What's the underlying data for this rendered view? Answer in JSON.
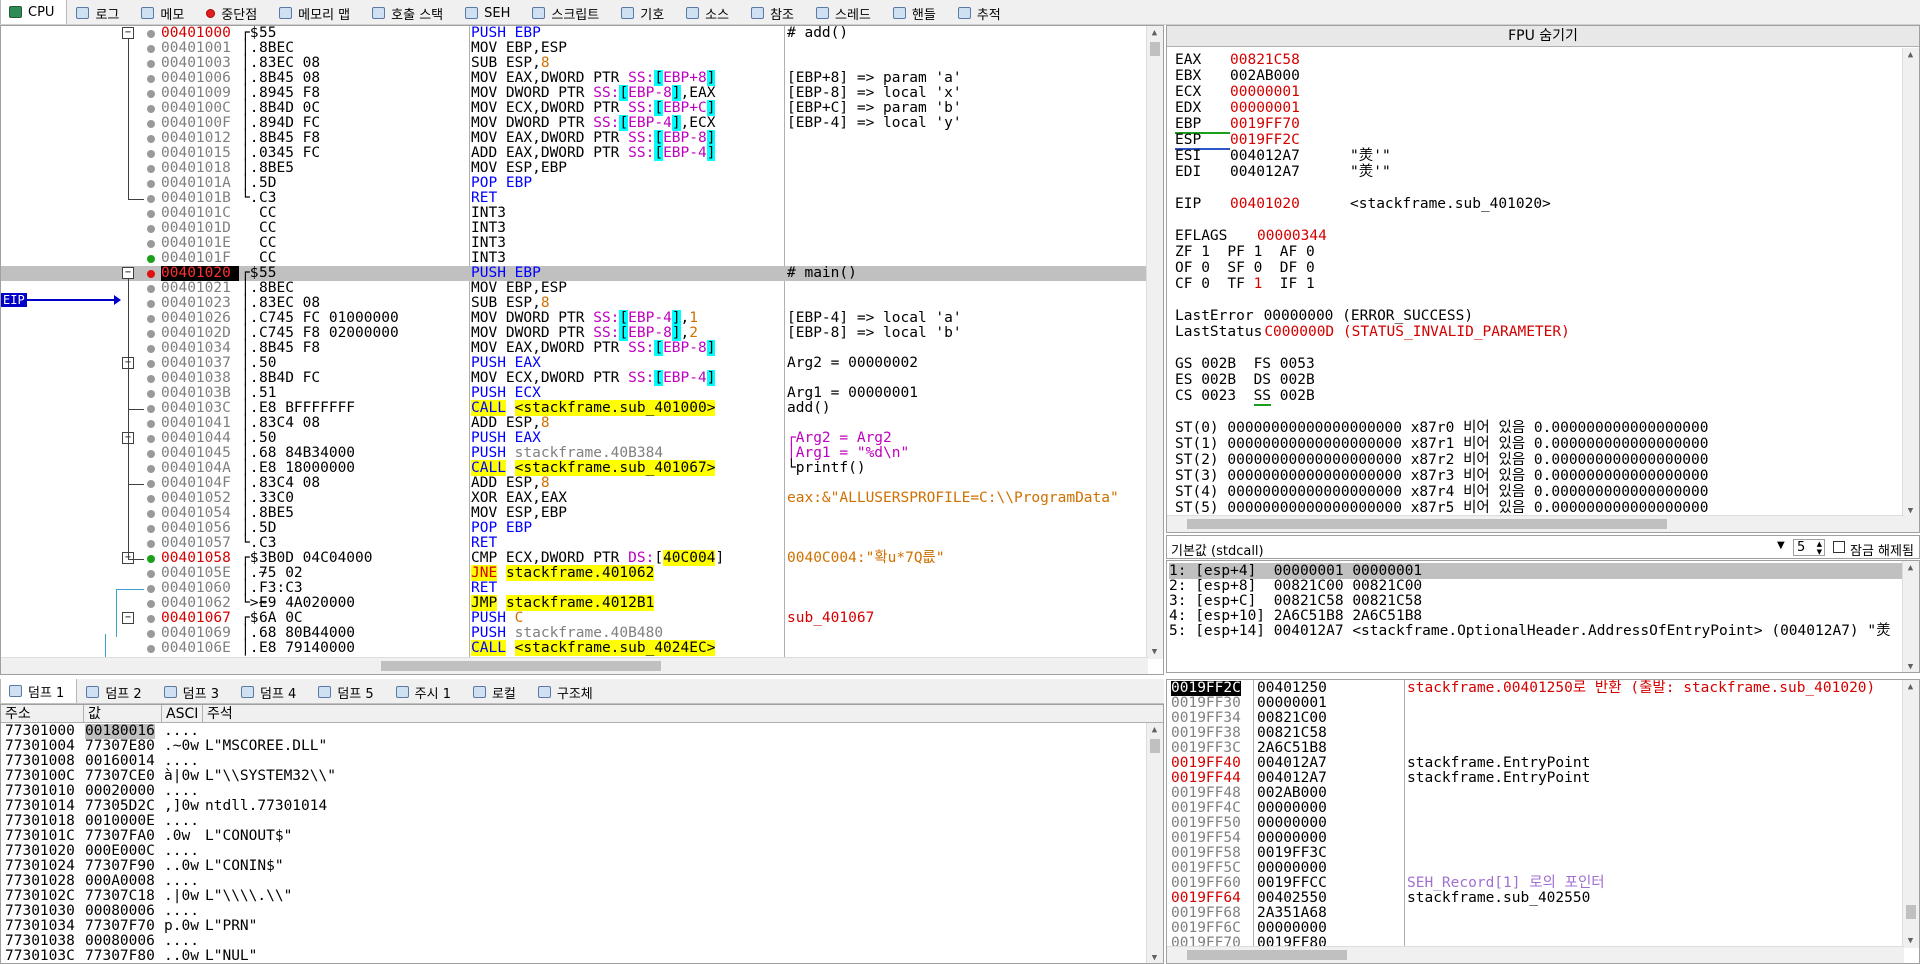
{
  "tabs": [
    {
      "label": "CPU",
      "icon": "cpu-icon",
      "active": true
    },
    {
      "label": "로그",
      "icon": "log-icon"
    },
    {
      "label": "메모",
      "icon": "notes-icon"
    },
    {
      "label": "중단점",
      "icon": "breakpoint-icon"
    },
    {
      "label": "메모리 맵",
      "icon": "memory-map-icon"
    },
    {
      "label": "호출 스택",
      "icon": "call-stack-icon"
    },
    {
      "label": "SEH",
      "icon": "seh-icon"
    },
    {
      "label": "스크립트",
      "icon": "script-icon"
    },
    {
      "label": "기호",
      "icon": "symbols-icon"
    },
    {
      "label": "소스",
      "icon": "source-icon"
    },
    {
      "label": "참조",
      "icon": "references-icon"
    },
    {
      "label": "스레드",
      "icon": "threads-icon"
    },
    {
      "label": "핸들",
      "icon": "handles-icon"
    },
    {
      "label": "추적",
      "icon": "trace-icon"
    }
  ],
  "eip_label": "EIP",
  "disasm": [
    {
      "a": "00401000",
      "l": 1,
      "k": "┌$",
      "b": "55",
      "i": [
        [
          "PUSH EBP",
          "bl"
        ]
      ],
      "c": "# add()"
    },
    {
      "a": "00401001",
      "k": "│.",
      "b": "8BEC",
      "i": [
        [
          "MOV EBP,ESP",
          ""
        ]
      ],
      "c": ""
    },
    {
      "a": "00401003",
      "k": "│.",
      "b": "83EC 08",
      "i": [
        [
          "SUB ESP,",
          ""
        ],
        [
          "8",
          "or"
        ]
      ],
      "c": ""
    },
    {
      "a": "00401006",
      "k": "│.",
      "b": "8B45 08",
      "i": [
        [
          "MOV EAX,DWORD PTR ",
          ""
        ],
        [
          "SS:",
          "mg"
        ],
        [
          "[",
          "hl"
        ],
        [
          "EBP+8",
          "mg"
        ],
        [
          "]",
          "hl"
        ]
      ],
      "c": "[EBP+8] => param 'a'"
    },
    {
      "a": "00401009",
      "k": "│.",
      "b": "8945 F8",
      "i": [
        [
          "MOV DWORD PTR ",
          ""
        ],
        [
          "SS:",
          "mg"
        ],
        [
          "[",
          "hl"
        ],
        [
          "EBP-8",
          "mg"
        ],
        [
          "]",
          "hl"
        ],
        [
          ",EAX",
          ""
        ]
      ],
      "c": "[EBP-8] => local 'x'"
    },
    {
      "a": "0040100C",
      "k": "│.",
      "b": "8B4D 0C",
      "i": [
        [
          "MOV ECX,DWORD PTR ",
          ""
        ],
        [
          "SS:",
          "mg"
        ],
        [
          "[",
          "hl"
        ],
        [
          "EBP+C",
          "mg"
        ],
        [
          "]",
          "hl"
        ]
      ],
      "c": "[EBP+C] => param 'b'"
    },
    {
      "a": "0040100F",
      "k": "│.",
      "b": "894D FC",
      "i": [
        [
          "MOV DWORD PTR ",
          ""
        ],
        [
          "SS:",
          "mg"
        ],
        [
          "[",
          "hl"
        ],
        [
          "EBP-4",
          "mg"
        ],
        [
          "]",
          "hl"
        ],
        [
          ",ECX",
          ""
        ]
      ],
      "c": "[EBP-4] => local 'y'"
    },
    {
      "a": "00401012",
      "k": "│.",
      "b": "8B45 F8",
      "i": [
        [
          "MOV EAX,DWORD PTR ",
          ""
        ],
        [
          "SS:",
          "mg"
        ],
        [
          "[",
          "hl"
        ],
        [
          "EBP-8",
          "mg"
        ],
        [
          "]",
          "hl"
        ]
      ],
      "c": ""
    },
    {
      "a": "00401015",
      "k": "│.",
      "b": "0345 FC",
      "i": [
        [
          "ADD EAX,DWORD PTR ",
          ""
        ],
        [
          "SS:",
          "mg"
        ],
        [
          "[",
          "hl"
        ],
        [
          "EBP-4",
          "mg"
        ],
        [
          "]",
          "hl"
        ]
      ],
      "c": ""
    },
    {
      "a": "00401018",
      "k": "│.",
      "b": "8BE5",
      "i": [
        [
          "MOV ESP,EBP",
          ""
        ]
      ],
      "c": ""
    },
    {
      "a": "0040101A",
      "k": "│.",
      "b": "5D",
      "i": [
        [
          "POP EBP",
          "bl"
        ]
      ],
      "c": ""
    },
    {
      "a": "0040101B",
      "k": "└.",
      "b": "C3",
      "i": [
        [
          "RET",
          "bl"
        ]
      ],
      "c": ""
    },
    {
      "a": "0040101C",
      "k": "",
      "b": "CC",
      "i": [
        [
          "INT3",
          ""
        ]
      ],
      "c": ""
    },
    {
      "a": "0040101D",
      "k": "",
      "b": "CC",
      "i": [
        [
          "INT3",
          ""
        ]
      ],
      "c": ""
    },
    {
      "a": "0040101E",
      "k": "",
      "b": "CC",
      "i": [
        [
          "INT3",
          ""
        ]
      ],
      "c": ""
    },
    {
      "a": "0040101F",
      "k": "",
      "b": "CC",
      "i": [
        [
          "INT3",
          ""
        ]
      ],
      "c": ""
    },
    {
      "a": "00401020",
      "l": 1,
      "e": 1,
      "k": "┌$",
      "b": "55",
      "i": [
        [
          "PUSH EBP",
          "bl"
        ]
      ],
      "c": "# main()"
    },
    {
      "a": "00401021",
      "k": "│.",
      "b": "8BEC",
      "i": [
        [
          "MOV EBP,ESP",
          ""
        ]
      ],
      "c": ""
    },
    {
      "a": "00401023",
      "k": "│.",
      "b": "83EC 08",
      "i": [
        [
          "SUB ESP,",
          ""
        ],
        [
          "8",
          "or"
        ]
      ],
      "c": ""
    },
    {
      "a": "00401026",
      "k": "│.",
      "b": "C745 FC 01000000",
      "i": [
        [
          "MOV DWORD PTR ",
          ""
        ],
        [
          "SS:",
          "mg"
        ],
        [
          "[",
          "hl"
        ],
        [
          "EBP-4",
          "mg"
        ],
        [
          "]",
          "hl"
        ],
        [
          ",",
          ""
        ],
        [
          "1",
          "or"
        ]
      ],
      "c": "[EBP-4] => local 'a'"
    },
    {
      "a": "0040102D",
      "k": "│.",
      "b": "C745 F8 02000000",
      "i": [
        [
          "MOV DWORD PTR ",
          ""
        ],
        [
          "SS:",
          "mg"
        ],
        [
          "[",
          "hl"
        ],
        [
          "EBP-8",
          "mg"
        ],
        [
          "]",
          "hl"
        ],
        [
          ",",
          ""
        ],
        [
          "2",
          "or"
        ]
      ],
      "c": "[EBP-8] => local 'b'"
    },
    {
      "a": "00401034",
      "k": "│.",
      "b": "8B45 F8",
      "i": [
        [
          "MOV EAX,DWORD PTR ",
          ""
        ],
        [
          "SS:",
          "mg"
        ],
        [
          "[",
          "hl"
        ],
        [
          "EBP-8",
          "mg"
        ],
        [
          "]",
          "hl"
        ]
      ],
      "c": ""
    },
    {
      "a": "00401037",
      "k": "│.",
      "b": "50",
      "i": [
        [
          "PUSH EAX",
          "bl"
        ]
      ],
      "c": "Arg2 = 00000002"
    },
    {
      "a": "00401038",
      "k": "│.",
      "b": "8B4D FC",
      "i": [
        [
          "MOV ECX,DWORD PTR ",
          ""
        ],
        [
          "SS:",
          "mg"
        ],
        [
          "[",
          "hl"
        ],
        [
          "EBP-4",
          "mg"
        ],
        [
          "]",
          "hl"
        ]
      ],
      "c": ""
    },
    {
      "a": "0040103B",
      "k": "│.",
      "b": "51",
      "i": [
        [
          "PUSH ECX",
          "bl"
        ]
      ],
      "c": "Arg1 = 00000001"
    },
    {
      "a": "0040103C",
      "k": "│.",
      "b": "E8 BFFFFFFF",
      "i": [
        [
          "CALL",
          "bl yl"
        ],
        [
          " ",
          ""
        ],
        [
          "<stackframe.sub_401000>",
          "yl"
        ]
      ],
      "c": "add()"
    },
    {
      "a": "00401041",
      "k": "│.",
      "b": "83C4 08",
      "i": [
        [
          "ADD ESP,",
          ""
        ],
        [
          "8",
          "or"
        ]
      ],
      "c": ""
    },
    {
      "a": "00401044",
      "k": "│.",
      "b": "50",
      "i": [
        [
          "PUSH EAX",
          "bl"
        ]
      ],
      "c": "┌Arg2 = Arg2",
      "cc": "mg"
    },
    {
      "a": "00401045",
      "k": "│.",
      "b": "68 84B34000",
      "i": [
        [
          "PUSH ",
          "bl"
        ],
        [
          "stackframe.40B384",
          "gr"
        ]
      ],
      "c": "│Arg1 = \"%d\\n\"",
      "cc": "mg"
    },
    {
      "a": "0040104A",
      "k": "│.",
      "b": "E8 18000000",
      "i": [
        [
          "CALL",
          "bl yl"
        ],
        [
          " ",
          ""
        ],
        [
          "<stackframe.sub_401067>",
          "yl"
        ]
      ],
      "c": "└printf()"
    },
    {
      "a": "0040104F",
      "k": "│.",
      "b": "83C4 08",
      "i": [
        [
          "ADD ESP,",
          ""
        ],
        [
          "8",
          "or"
        ]
      ],
      "c": ""
    },
    {
      "a": "00401052",
      "k": "│.",
      "b": "33C0",
      "i": [
        [
          "XOR EAX,EAX",
          ""
        ]
      ],
      "c": "eax:&\"ALLUSERSPROFILE=C:\\\\ProgramData\"",
      "cc": "or"
    },
    {
      "a": "00401054",
      "k": "│.",
      "b": "8BE5",
      "i": [
        [
          "MOV ESP,EBP",
          ""
        ]
      ],
      "c": ""
    },
    {
      "a": "00401056",
      "k": "│.",
      "b": "5D",
      "i": [
        [
          "POP EBP",
          "bl"
        ]
      ],
      "c": ""
    },
    {
      "a": "00401057",
      "k": "└.",
      "b": "C3",
      "i": [
        [
          "RET",
          "bl"
        ]
      ],
      "c": ""
    },
    {
      "a": "00401058",
      "l": 1,
      "k": "┌$",
      "b": "3B0D 04C04000",
      "i": [
        [
          "CMP ECX,DWORD PTR ",
          ""
        ],
        [
          "DS:",
          "mg"
        ],
        [
          "[",
          ""
        ],
        [
          "40C004",
          "yl"
        ],
        [
          "]",
          ""
        ]
      ],
      "c": "0040C004:\"확u*7Q릆\"",
      "cc": "or"
    },
    {
      "a": "0040105E",
      "k": "│.~",
      "b": "75 02",
      "i": [
        [
          "JNE",
          "rd yl"
        ],
        [
          " ",
          ""
        ],
        [
          "stackframe.401062",
          "yl"
        ]
      ],
      "c": ""
    },
    {
      "a": "00401060",
      "k": "│.",
      "b": "F3:C3",
      "i": [
        [
          "RET",
          "bl"
        ]
      ],
      "c": ""
    },
    {
      "a": "00401062",
      "k": "└>~",
      "b": "E9 4A020000",
      "i": [
        [
          "JMP",
          "yl"
        ],
        [
          " ",
          ""
        ],
        [
          "stackframe.4012B1",
          "yl"
        ]
      ],
      "c": ""
    },
    {
      "a": "00401067",
      "l": 1,
      "k": "┌$",
      "b": "6A 0C",
      "i": [
        [
          "PUSH ",
          "bl"
        ],
        [
          "C",
          "or"
        ]
      ],
      "c": "sub_401067",
      "cc": "rd"
    },
    {
      "a": "00401069",
      "k": "│.",
      "b": "68 80B44000",
      "i": [
        [
          "PUSH ",
          "bl"
        ],
        [
          "stackframe.40B480",
          "gr"
        ]
      ],
      "c": ""
    },
    {
      "a": "0040106E",
      "k": "│.",
      "b": "E8 79140000",
      "i": [
        [
          "CALL",
          "bl yl"
        ],
        [
          " ",
          ""
        ],
        [
          "<stackframe.sub_4024EC>",
          "yl"
        ]
      ],
      "c": ""
    }
  ],
  "fpu_title": "FPU 숨기기",
  "regs": [
    {
      "n": "EAX",
      "v": "00821C58",
      "r": 1,
      "x": ""
    },
    {
      "n": "EBX",
      "v": "002AB000",
      "x": ""
    },
    {
      "n": "ECX",
      "v": "00000001",
      "r": 1,
      "x": ""
    },
    {
      "n": "EDX",
      "v": "00000001",
      "r": 1,
      "x": ""
    },
    {
      "n": "EBP",
      "v": "0019FF70",
      "r": 1,
      "x": "",
      "u": "green"
    },
    {
      "n": "ESP",
      "v": "0019FF2C",
      "r": 1,
      "x": "",
      "u": "blue"
    },
    {
      "n": "ESI",
      "v": "004012A7",
      "x": "\"羙'\""
    },
    {
      "n": "EDI",
      "v": "004012A7",
      "x": "\"羙'\""
    }
  ],
  "eip": {
    "n": "EIP",
    "v": "00401020",
    "x": "<stackframe.sub_401020>"
  },
  "eflags": {
    "n": "EFLAGS",
    "v": "00000344"
  },
  "flags": [
    "ZF 1  PF 1  AF 0",
    "OF 0  SF 0  DF 0"
  ],
  "flags_cf": {
    "a": "CF 0  TF ",
    "b": "1",
    "c": "  IF 1"
  },
  "lasterror": {
    "n": "LastError",
    "v": "00000000 (ERROR_SUCCESS)"
  },
  "laststatus": {
    "n": "LastStatus",
    "v": "C000000D (STATUS_INVALID_PARAMETER)"
  },
  "segs": [
    "GS 002B  FS 0053",
    "ES 002B  DS 002B"
  ],
  "seg_cs": {
    "a": "CS 0023  ",
    "b": "SS",
    "c": " 002B"
  },
  "st": [
    "ST(0) 00000000000000000000 x87r0 비어 있음 0.000000000000000000",
    "ST(1) 00000000000000000000 x87r1 비어 있음 0.000000000000000000",
    "ST(2) 00000000000000000000 x87r2 비어 있음 0.000000000000000000",
    "ST(3) 00000000000000000000 x87r3 비어 있음 0.000000000000000000",
    "ST(4) 00000000000000000000 x87r4 비어 있음 0.000000000000000000",
    "ST(5) 00000000000000000000 x87r5 비어 있음 0.000000000000000000"
  ],
  "callconv": {
    "label": "기본값 (stdcall)",
    "count": "5",
    "lock_label": "잠금 해제됨"
  },
  "args": [
    "1: [esp+4]  00000001 00000001",
    "2: [esp+8]  00821C00 00821C00",
    "3: [esp+C]  00821C58 00821C58",
    "4: [esp+10] 2A6C51B8 2A6C51B8",
    "5: [esp+14] 004012A7 <stackframe.OptionalHeader.AddressOfEntryPoint> (004012A7) \"羙"
  ],
  "dump_tabs": [
    {
      "label": "덤프 1",
      "active": true
    },
    {
      "label": "덤프 2"
    },
    {
      "label": "덤프 3"
    },
    {
      "label": "덤프 4"
    },
    {
      "label": "덤프 5"
    },
    {
      "label": "주시 1"
    },
    {
      "label": "로컬"
    },
    {
      "label": "구조체"
    }
  ],
  "dump_headers": {
    "addr": "주소",
    "val": "값",
    "ascii": "ASCI",
    "comment": "주석"
  },
  "dump": [
    {
      "a": "77301000",
      "v": "00180016",
      "s": "....",
      "c": ""
    },
    {
      "a": "77301004",
      "v": "77307E80",
      "s": ".~0w",
      "c": "L\"MSCOREE.DLL\""
    },
    {
      "a": "77301008",
      "v": "00160014",
      "s": "....",
      "c": ""
    },
    {
      "a": "7730100C",
      "v": "77307CE0",
      "s": "à|0w",
      "c": "L\"\\\\SYSTEM32\\\\\""
    },
    {
      "a": "77301010",
      "v": "00020000",
      "s": "....",
      "c": ""
    },
    {
      "a": "77301014",
      "v": "77305D2C",
      "s": ",]0w",
      "c": "ntdll.77301014"
    },
    {
      "a": "77301018",
      "v": "0010000E",
      "s": "....",
      "c": ""
    },
    {
      "a": "7730101C",
      "v": "77307FA0",
      "s": ".0w",
      "c": "L\"CONOUT$\""
    },
    {
      "a": "77301020",
      "v": "000E000C",
      "s": "....",
      "c": ""
    },
    {
      "a": "77301024",
      "v": "77307F90",
      "s": "..0w",
      "c": "L\"CONIN$\""
    },
    {
      "a": "77301028",
      "v": "000A0008",
      "s": "....",
      "c": ""
    },
    {
      "a": "7730102C",
      "v": "77307C18",
      "s": ".|0w",
      "c": "L\"\\\\\\\\.\\\\\""
    },
    {
      "a": "77301030",
      "v": "00080006",
      "s": "....",
      "c": ""
    },
    {
      "a": "77301034",
      "v": "77307F70",
      "s": "p.0w",
      "c": "L\"PRN\""
    },
    {
      "a": "77301038",
      "v": "00080006",
      "s": "....",
      "c": ""
    },
    {
      "a": "7730103C",
      "v": "77307F80",
      "s": "..0w",
      "c": "L\"NUL\""
    }
  ],
  "stack": [
    {
      "a": "0019FF2C",
      "v": "00401250",
      "c": "stackframe.00401250로 반환 (출발: stackframe.sub_401020)",
      "sel": 1,
      "cc": "rd"
    },
    {
      "a": "0019FF30",
      "v": "00000001",
      "c": ""
    },
    {
      "a": "0019FF34",
      "v": "00821C00",
      "c": ""
    },
    {
      "a": "0019FF38",
      "v": "00821C58",
      "c": ""
    },
    {
      "a": "0019FF3C",
      "v": "2A6C51B8",
      "c": ""
    },
    {
      "a": "0019FF40",
      "v": "004012A7",
      "c": "stackframe.EntryPoint",
      "r": 1
    },
    {
      "a": "0019FF44",
      "v": "004012A7",
      "c": "stackframe.EntryPoint",
      "r": 1
    },
    {
      "a": "0019FF48",
      "v": "002AB000",
      "c": ""
    },
    {
      "a": "0019FF4C",
      "v": "00000000",
      "c": ""
    },
    {
      "a": "0019FF50",
      "v": "00000000",
      "c": ""
    },
    {
      "a": "0019FF54",
      "v": "00000000",
      "c": ""
    },
    {
      "a": "0019FF58",
      "v": "0019FF3C",
      "c": ""
    },
    {
      "a": "0019FF5C",
      "v": "00000000",
      "c": ""
    },
    {
      "a": "0019FF60",
      "v": "0019FFCC",
      "c": "SEH_Record[1] 로의 포인터",
      "cc": "pu"
    },
    {
      "a": "0019FF64",
      "v": "00402550",
      "c": "stackframe.sub_402550",
      "r": 1
    },
    {
      "a": "0019FF68",
      "v": "2A351A68",
      "c": ""
    },
    {
      "a": "0019FF6C",
      "v": "00000000",
      "c": ""
    },
    {
      "a": "0019FF70",
      "v": "0019FF80",
      "c": ""
    }
  ]
}
